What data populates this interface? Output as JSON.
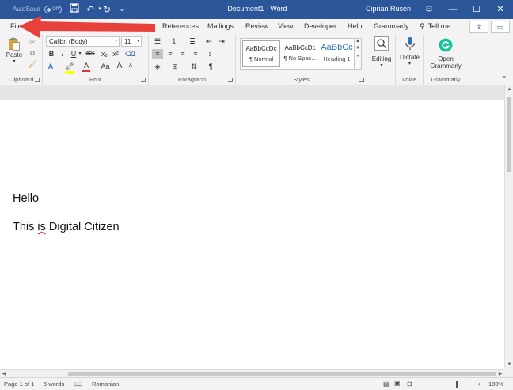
{
  "titlebar": {
    "autosave_label": "AutoSave",
    "autosave_state": "Off",
    "doc_title": "Document1 - Word",
    "user_name": "Ciprian Rusen"
  },
  "tabs": {
    "file": "File",
    "references": "References",
    "mailings": "Mailings",
    "review": "Review",
    "view": "View",
    "developer": "Developer",
    "help": "Help",
    "grammarly": "Grammarly",
    "tell_me": "Tell me"
  },
  "ribbon": {
    "clipboard": {
      "label": "Clipboard",
      "paste": "Paste"
    },
    "font": {
      "label": "Font",
      "family": "Calibri (Body)",
      "size": "11",
      "bold": "B",
      "italic": "I",
      "underline": "U",
      "strike": "abc",
      "subscript": "x₂",
      "superscript": "x²",
      "text_effects": "A",
      "font_color": "A",
      "case": "Aa",
      "grow": "A",
      "shrink": "A"
    },
    "paragraph": {
      "label": "Paragraph",
      "pilcrow": "¶"
    },
    "styles": {
      "label": "Styles",
      "items": [
        {
          "sample": "AaBbCcDc",
          "name": "¶ Normal"
        },
        {
          "sample": "AaBbCcDc",
          "name": "¶ No Spac..."
        },
        {
          "sample": "AaBbCc",
          "name": "Heading 1"
        }
      ]
    },
    "editing": {
      "label": "Editing"
    },
    "voice": {
      "label": "Voice",
      "dictate": "Dictate"
    },
    "grammarly": {
      "label": "Grammarly",
      "open_line1": "Open",
      "open_line2": "Grammarly"
    }
  },
  "document": {
    "lines": [
      "Hello",
      "This ",
      "is",
      " Digital Citizen"
    ]
  },
  "status": {
    "page": "Page 1 of 1",
    "words": "5 words",
    "language": "Romanian",
    "zoom": "180%",
    "minus": "−",
    "plus": "+"
  },
  "colors": {
    "title_blue": "#2b579a",
    "arrow_red": "#e8413c",
    "grammarly_green": "#15c39a"
  }
}
